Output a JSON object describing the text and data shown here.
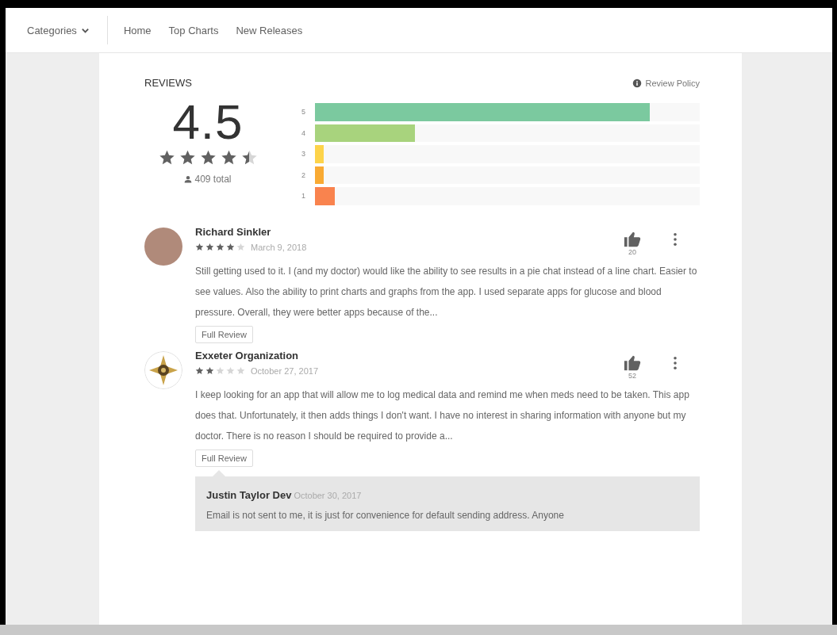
{
  "nav": {
    "categories": "Categories",
    "links": [
      {
        "label": "Home"
      },
      {
        "label": "Top Charts"
      },
      {
        "label": "New Releases"
      }
    ]
  },
  "reviews": {
    "heading": "REVIEWS",
    "policy_link": "Review Policy",
    "average": "4.5",
    "stars": 4.5,
    "total": "409 total",
    "histogram": [
      {
        "label": "5",
        "level": 0.87,
        "color": "#7bc99f"
      },
      {
        "label": "4",
        "level": 0.26,
        "color": "#a8d37d"
      },
      {
        "label": "3",
        "level": 0.022,
        "color": "#fdd34a"
      },
      {
        "label": "2",
        "level": 0.022,
        "color": "#f9aa33"
      },
      {
        "label": "1",
        "level": 0.052,
        "color": "#f9834e"
      }
    ],
    "items": [
      {
        "author": "Richard Sinkler",
        "stars": 4,
        "date": "March 9, 2018",
        "likes": "20",
        "kind": "photo",
        "text": "Still getting used to it. I (and my doctor) would like the ability to see results in a pie chat instead of a line chart. Easier to see values. Also the ability to print charts and graphs from the app. I used separate apps for glucose and blood pressure. Overall, they were better apps because of the...",
        "button": "Full Review"
      },
      {
        "author": "Exxeter Organization",
        "stars": 2,
        "date": "October 27, 2017",
        "likes": "52",
        "kind": "emblem",
        "text": "I keep looking for an app that will allow me to log medical data and remind me when meds need to be taken. This app does that. Unfortunately, it then adds things I don't want. I have no interest in sharing information with anyone but my doctor. There is no reason I should be required to provide a...",
        "button": "Full Review",
        "reply": {
          "author": "Justin Taylor Dev",
          "date": "October 30, 2017",
          "text": "Email is not sent to me, it is just for convenience for default sending address. Anyone"
        }
      }
    ]
  }
}
